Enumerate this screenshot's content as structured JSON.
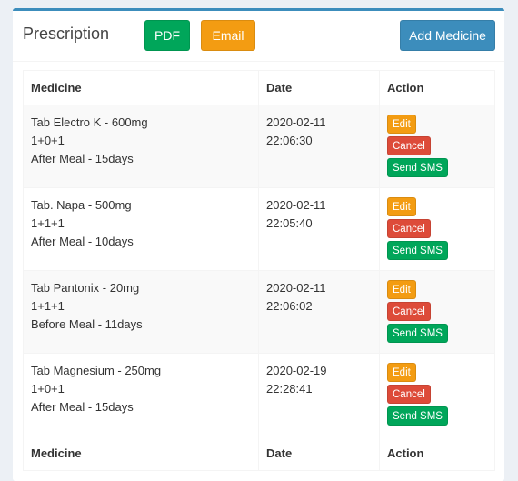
{
  "header": {
    "title": "Prescription",
    "pdf": "PDF",
    "email": "Email",
    "add": "Add Medicine"
  },
  "columns": [
    "Medicine",
    "Date",
    "Action"
  ],
  "actions": {
    "edit": "Edit",
    "cancel": "Cancel",
    "sms": "Send SMS"
  },
  "rows": [
    {
      "name": "Tab Electro K - 600mg",
      "dose": "1+0+1",
      "instruction": "After Meal - 15days",
      "date": "2020-02-11",
      "time": "22:06:30"
    },
    {
      "name": "Tab. Napa - 500mg",
      "dose": "1+1+1",
      "instruction": "After Meal - 10days",
      "date": "2020-02-11",
      "time": "22:05:40"
    },
    {
      "name": "Tab Pantonix - 20mg",
      "dose": "1+1+1",
      "instruction": "Before Meal - 11days",
      "date": "2020-02-11",
      "time": "22:06:02"
    },
    {
      "name": "Tab Magnesium - 250mg",
      "dose": "1+0+1",
      "instruction": "After Meal - 15days",
      "date": "2020-02-19",
      "time": "22:28:41"
    }
  ]
}
